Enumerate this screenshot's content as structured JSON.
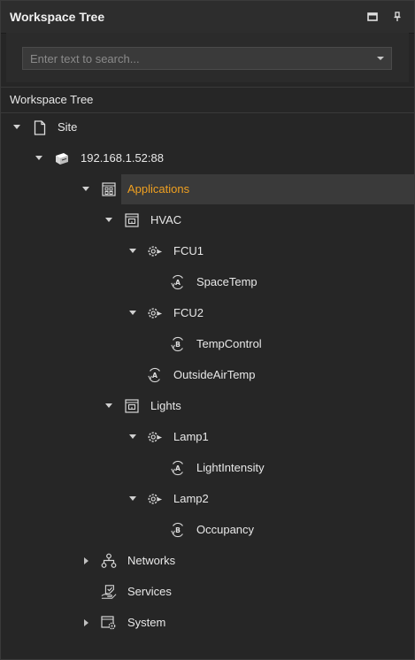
{
  "panel": {
    "title": "Workspace Tree",
    "buttons": [
      "restore-icon",
      "pin-icon"
    ]
  },
  "search": {
    "placeholder": "Enter text to search...",
    "value": ""
  },
  "section_header": "Workspace Tree",
  "colors": {
    "selected_text": "#f0a020",
    "text": "#e8e8e8",
    "background": "#262626"
  },
  "tree": {
    "site": "Site",
    "server": "192.168.1.52:88",
    "applications": "Applications",
    "hvac": "HVAC",
    "fcu1": "FCU1",
    "spacetemp": "SpaceTemp",
    "fcu2": "FCU2",
    "tempcontrol": "TempControl",
    "outsideairtemp": "OutsideAirTemp",
    "lights": "Lights",
    "lamp1": "Lamp1",
    "lightintensity": "LightIntensity",
    "lamp2": "Lamp2",
    "occupancy": "Occupancy",
    "networks": "Networks",
    "services": "Services",
    "system": "System"
  },
  "selected_item": "Applications"
}
